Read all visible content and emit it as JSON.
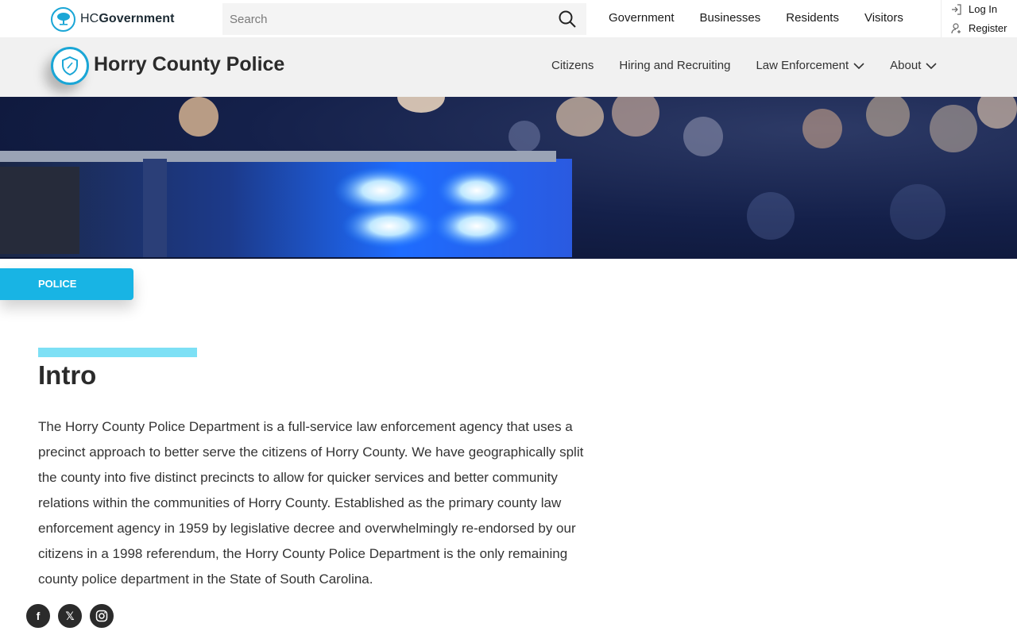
{
  "topbar": {
    "brand_prefix": "HC",
    "brand_suffix": "Government",
    "search_placeholder": "Search",
    "nav": [
      "Government",
      "Businesses",
      "Residents",
      "Visitors"
    ],
    "login_label": "Log In",
    "register_label": "Register"
  },
  "department": {
    "title": "Horry County Police",
    "nav": [
      {
        "label": "Citizens",
        "dropdown": false
      },
      {
        "label": "Hiring and Recruiting",
        "dropdown": false
      },
      {
        "label": "Law Enforcement",
        "dropdown": true
      },
      {
        "label": "About",
        "dropdown": true
      }
    ]
  },
  "content": {
    "badge": "POLICE",
    "heading": "Intro",
    "paragraph": "The Horry County Police Department is a full-service law enforcement agency that uses a precinct approach to better serve the citizens of Horry County. We have geographically split the county into five distinct precincts to allow for quicker services and better community relations within the communities of Horry County. Established as the primary county law enforcement agency in 1959 by legislative decree and overwhelmingly re-endorsed by our citizens in a 1998 referendum, the Horry County Police Department is the only remaining county police department in the State of South Carolina."
  },
  "social": {
    "facebook": "f",
    "x": "𝕏",
    "instagram": "instagram"
  },
  "colors": {
    "accent": "#18b4e4",
    "accent_light": "#7de0f5"
  }
}
